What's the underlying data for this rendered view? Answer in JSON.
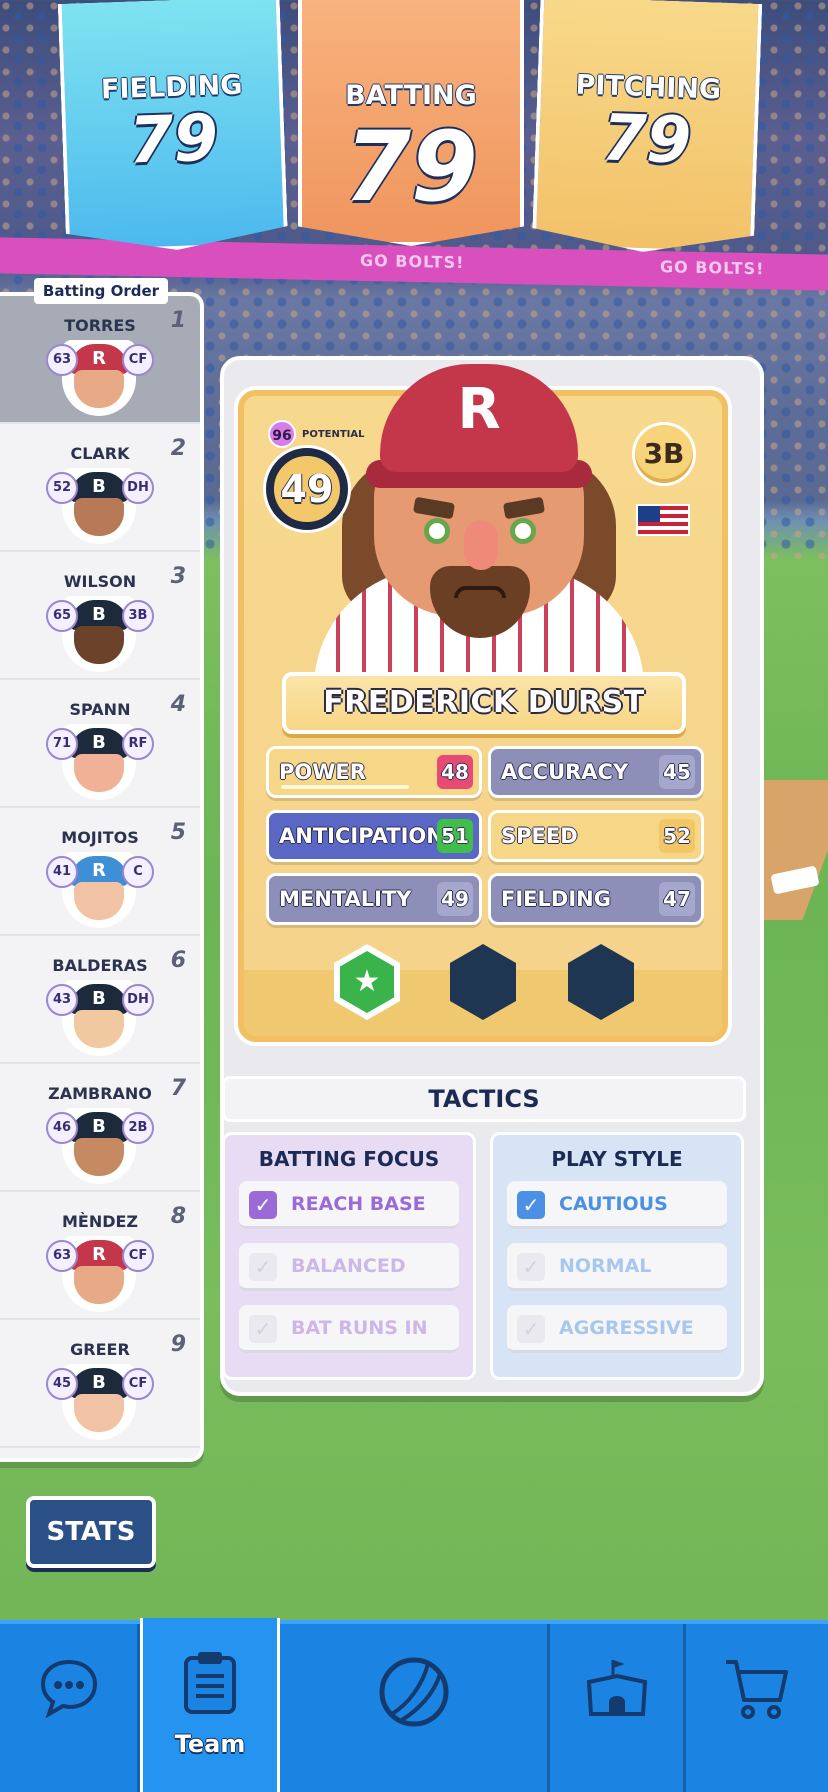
{
  "top_cards": {
    "fielding": {
      "label": "FIELDING",
      "value": "79"
    },
    "batting": {
      "label": "BATTING",
      "value": "79"
    },
    "pitching": {
      "label": "PITCHING",
      "value": "79"
    }
  },
  "banner_text": "GO BOLTS!",
  "batting_order": {
    "title": "Batting Order",
    "players": [
      {
        "name": "TORRES",
        "order": "1",
        "rating": "63",
        "position": "CF",
        "cap": "R"
      },
      {
        "name": "CLARK",
        "order": "2",
        "rating": "52",
        "position": "DH",
        "cap": "B"
      },
      {
        "name": "WILSON",
        "order": "3",
        "rating": "65",
        "position": "3B",
        "cap": "B"
      },
      {
        "name": "SPANN",
        "order": "4",
        "rating": "71",
        "position": "RF",
        "cap": "B"
      },
      {
        "name": "MOJITOS",
        "order": "5",
        "rating": "41",
        "position": "C",
        "cap": "R"
      },
      {
        "name": "BALDERAS",
        "order": "6",
        "rating": "43",
        "position": "DH",
        "cap": "B"
      },
      {
        "name": "ZAMBRANO",
        "order": "7",
        "rating": "46",
        "position": "2B",
        "cap": "B"
      },
      {
        "name": "MÈNDEZ",
        "order": "8",
        "rating": "63",
        "position": "CF",
        "cap": "R"
      },
      {
        "name": "GREER",
        "order": "9",
        "rating": "45",
        "position": "CF",
        "cap": "B"
      }
    ]
  },
  "stats_button": "STATS",
  "player_card": {
    "potential_value": "96",
    "potential_label": "POTENTIAL",
    "rating": "49",
    "position": "3B",
    "cap_letter": "R",
    "name": "FREDERICK DURST",
    "stats": {
      "power": {
        "label": "POWER",
        "value": "48"
      },
      "accuracy": {
        "label": "ACCURACY",
        "value": "45"
      },
      "anticipation": {
        "label": "ANTICIPATION",
        "value": "51"
      },
      "speed": {
        "label": "SPEED",
        "value": "52"
      },
      "mentality": {
        "label": "MENTALITY",
        "value": "49"
      },
      "fielding": {
        "label": "FIELDING",
        "value": "47"
      }
    },
    "ability_icon": "★"
  },
  "tactics": {
    "title": "TACTICS",
    "batting_focus": {
      "title": "BATTING FOCUS",
      "options": [
        {
          "label": "REACH BASE",
          "checked": true
        },
        {
          "label": "BALANCED",
          "checked": false
        },
        {
          "label": "BAT RUNS IN",
          "checked": false
        }
      ]
    },
    "play_style": {
      "title": "PLAY STYLE",
      "options": [
        {
          "label": "CAUTIOUS",
          "checked": true
        },
        {
          "label": "NORMAL",
          "checked": false
        },
        {
          "label": "AGGRESSIVE",
          "checked": false
        }
      ]
    }
  },
  "check_mark": "✓",
  "bottom_nav": {
    "team_label": "Team",
    "icons": [
      "chat-icon",
      "clipboard-icon",
      "baseball-icon",
      "stadium-icon",
      "cart-icon"
    ]
  },
  "colors": {
    "nav": "#1b84e2",
    "accent_purple": "#9c6ad6",
    "accent_blue": "#4b90e5"
  }
}
